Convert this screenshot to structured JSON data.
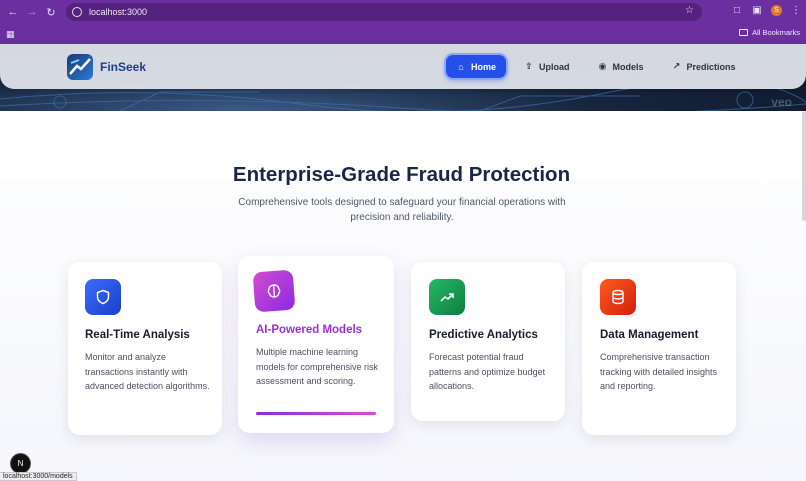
{
  "browser": {
    "url": "localhost:3000",
    "bookmarks_label": "All Bookmarks",
    "avatar_letter": "S",
    "status_url": "localhost:3000/models"
  },
  "site": {
    "brand": "FinSeek",
    "nav": [
      {
        "label": "Home",
        "icon": "home-icon",
        "active": true
      },
      {
        "label": "Upload",
        "icon": "upload-icon",
        "active": false
      },
      {
        "label": "Models",
        "icon": "models-icon",
        "active": false
      },
      {
        "label": "Predictions",
        "icon": "trend-up-icon",
        "active": false
      }
    ],
    "hero_watermark": "veo"
  },
  "section": {
    "title": "Enterprise-Grade Fraud Protection",
    "subtitle": "Comprehensive tools designed to safeguard your financial operations with precision and reliability."
  },
  "cards": [
    {
      "title": "Real-Time Analysis",
      "description": "Monitor and analyze transactions instantly with advanced detection algorithms.",
      "icon": "shield-icon",
      "color": "#1f4fe0",
      "highlighted": false
    },
    {
      "title": "AI-Powered Models",
      "description": "Multiple machine learning models for comprehensive risk assessment and scoring.",
      "icon": "brain-icon",
      "color": "#9b2fd6",
      "highlighted": true
    },
    {
      "title": "Predictive Analytics",
      "description": "Forecast potential fraud patterns and optimize budget allocations.",
      "icon": "trend-up-icon",
      "color": "#17914f",
      "highlighted": false
    },
    {
      "title": "Data Management",
      "description": "Comprehensive transaction tracking with detailed insights and reporting.",
      "icon": "database-icon",
      "color": "#e0320c",
      "highlighted": false
    }
  ],
  "devtools": {
    "badge": "N"
  }
}
